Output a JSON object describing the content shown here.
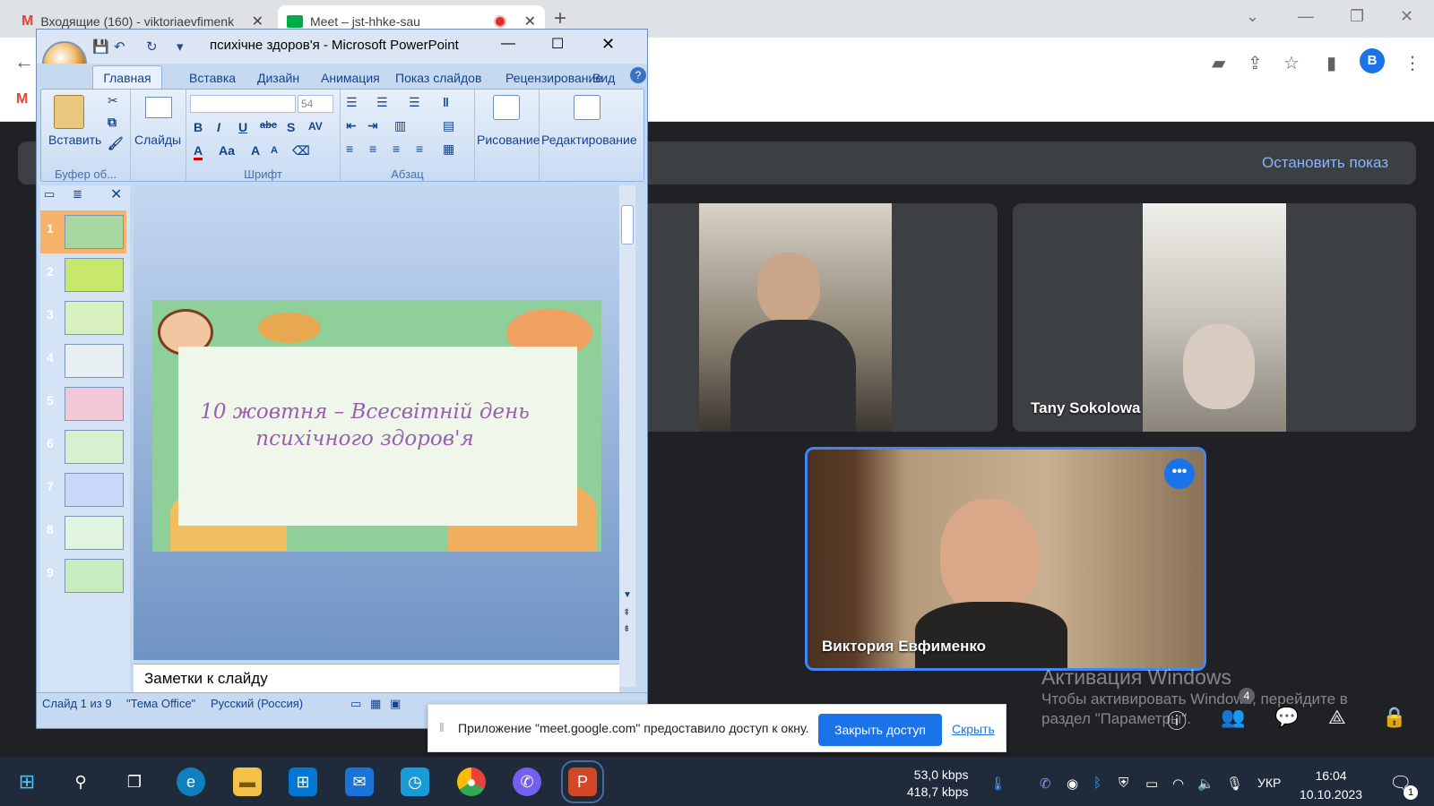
{
  "browser": {
    "tabs": [
      {
        "title": "Входящие (160) - viktoriaevfimenk",
        "icon": "gmail-icon"
      },
      {
        "title": "Meet – jst-hhke-sau",
        "icon": "meet-icon"
      }
    ],
    "new_tab": "+",
    "profile_initial": "B"
  },
  "meet": {
    "stop_presenting": "Остановить показ",
    "participants": [
      {
        "name": ""
      },
      {
        "name": "Tany Sokolowa"
      },
      {
        "name": "Виктория Евфименко"
      }
    ],
    "more_options": "•••",
    "people_count": "4"
  },
  "activation": {
    "title": "Активация Windows",
    "line1": "Чтобы активировать Windows, перейдите в",
    "line2": "раздел \"Параметры\"."
  },
  "share_banner": {
    "text": "Приложение \"meet.google.com\" предоставило доступ к окну.",
    "stop_button": "Закрыть доступ",
    "hide_link": "Скрыть"
  },
  "powerpoint": {
    "title": "психічне здоров'я - Microsoft PowerPoint",
    "tabs": [
      "Главная",
      "Вставка",
      "Дизайн",
      "Анимация",
      "Показ слайдов",
      "Рецензирование",
      "Вид"
    ],
    "groups": {
      "clipboard": "Буфер об...",
      "slides": "",
      "font": "Шрифт",
      "paragraph": "Абзац"
    },
    "buttons": {
      "paste": "Вставить",
      "slides": "Слайды",
      "drawing": "Рисование",
      "editing": "Редактирование"
    },
    "font_size": "54",
    "slide_numbers": [
      "1",
      "2",
      "3",
      "4",
      "5",
      "6",
      "7",
      "8",
      "9"
    ],
    "slide_title": "10 жовтня – Всесвітній день психічного здоров'я",
    "notes_placeholder": "Заметки к слайду",
    "status": {
      "slide": "Слайд 1 из 9",
      "theme": "\"Тема Office\"",
      "language": "Русский (Россия)"
    }
  },
  "taskbar": {
    "speed_up": "53,0 kbps",
    "speed_down": "418,7 kbps",
    "language": "УКР",
    "time": "16:04",
    "date": "10.10.2023",
    "notifications": "1"
  }
}
